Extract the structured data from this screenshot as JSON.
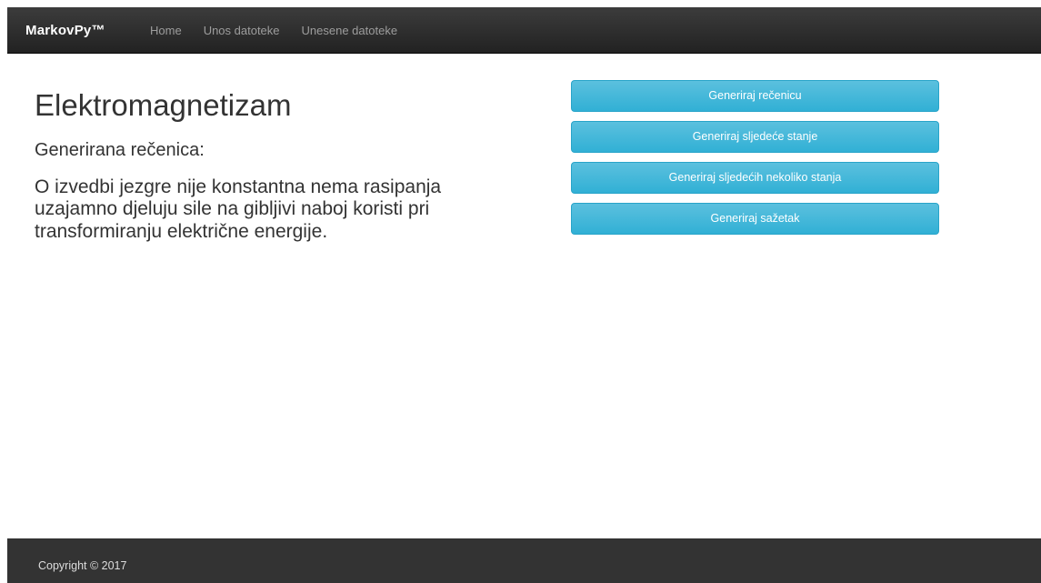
{
  "navbar": {
    "brand": "MarkovPy™",
    "links": [
      {
        "label": "Home"
      },
      {
        "label": "Unos datoteke"
      },
      {
        "label": "Unesene datoteke"
      }
    ]
  },
  "main": {
    "title": "Elektromagnetizam",
    "sentence_label": "Generirana rečenica:",
    "sentence_text": "O izvedbi jezgre nije konstantna nema rasipanja uzajamno djeluju sile na gibljivi naboj koristi pri transformiranju električne energije."
  },
  "actions": {
    "generate_sentence": "Generiraj rečenicu",
    "generate_next_state": "Generiraj sljedeće stanje",
    "generate_next_states": "Generiraj sljedećih nekoliko stanja",
    "generate_summary": "Generiraj sažetak"
  },
  "footer": {
    "copyright": "Copyright © 2017"
  },
  "colors": {
    "navbar": "#222222",
    "button_info": "#5bc0de",
    "footer": "#333333"
  }
}
